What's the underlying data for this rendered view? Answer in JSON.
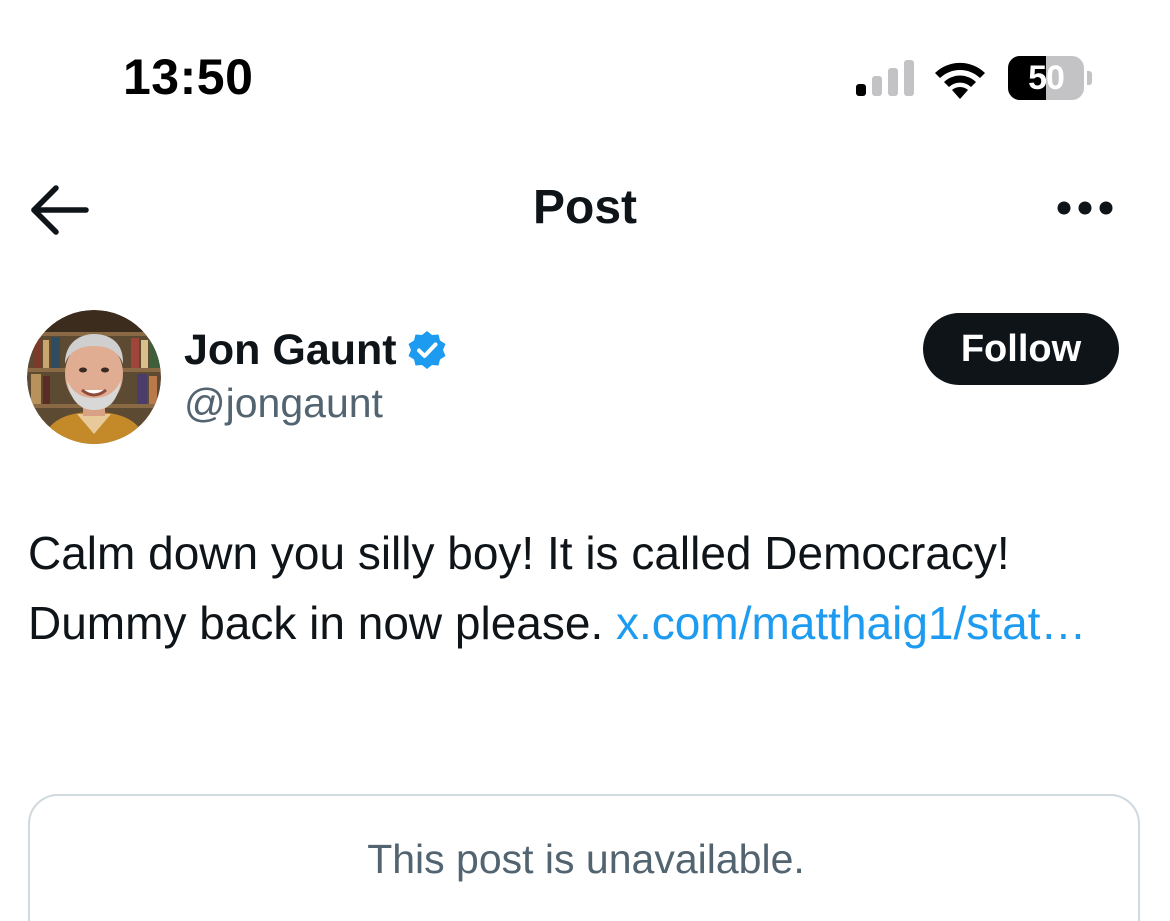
{
  "status_bar": {
    "time": "13:50",
    "battery_level": "50",
    "battery_fraction": 0.5,
    "signal_bars_active": 1,
    "signal_bars_total": 4,
    "icons": [
      "signal-icon",
      "wifi-icon",
      "battery-icon"
    ]
  },
  "header": {
    "title": "Post",
    "back_icon": "back-arrow-icon",
    "more_icon": "more-options-icon"
  },
  "author": {
    "name": "Jon Gaunt",
    "handle": "@jongaunt",
    "verified": true,
    "verified_color": "#1d9bf0",
    "follow_label": "Follow"
  },
  "post": {
    "text_before_link": "Calm down you silly boy! It is called Democracy! Dummy back in now please. ",
    "link_text": "x.com/matthaig1/​stat…",
    "link_color": "#1d9bf0"
  },
  "quoted_post": {
    "unavailable_text": "This post is unavailable."
  }
}
